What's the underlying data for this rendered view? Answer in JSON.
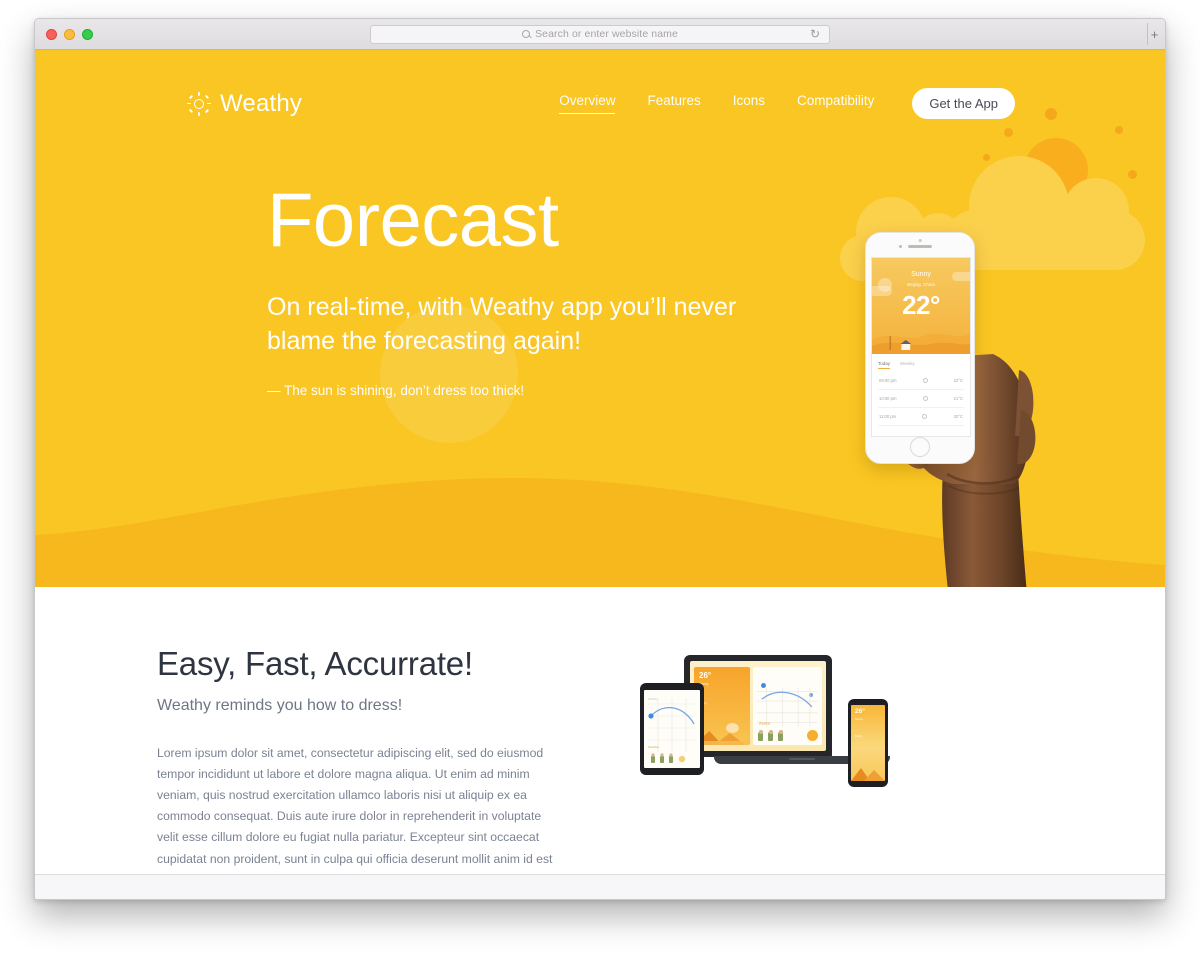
{
  "browser": {
    "address_placeholder": "Search or enter website name",
    "search_icon": "search-icon",
    "reload_icon": "↻",
    "new_tab_icon": "+",
    "traffic_lights": [
      "close",
      "minimize",
      "maximize"
    ]
  },
  "nav": {
    "brand": "Weathy",
    "brand_icon": "sun-icon",
    "links": [
      {
        "label": "Overview",
        "active": true
      },
      {
        "label": "Features",
        "active": false
      },
      {
        "label": "Icons",
        "active": false
      },
      {
        "label": "Compatibility",
        "active": false
      }
    ],
    "cta_label": "Get the App"
  },
  "hero": {
    "title": "Forecast",
    "subtitle": "On real-time, with Weathy app you’ll never blame the forecasting again!",
    "note": "— The sun is shining, don’t dress too thick!",
    "background_color": "#f9c623",
    "wave_color": "#f6b81d",
    "sun_color": "#f9ae1e",
    "cloud_color": "#fbd04b"
  },
  "phone_app": {
    "condition": "Sunny",
    "location": "Beijing, China",
    "temperature": "22°",
    "tabs": [
      {
        "label": "Today",
        "active": true
      },
      {
        "label": "Weekly",
        "active": false
      }
    ],
    "rows": [
      {
        "time": "09:00 pm",
        "icon": "sun-icon",
        "temp": "22°C"
      },
      {
        "time": "10:00 pm",
        "icon": "sun-icon",
        "temp": "21°C"
      },
      {
        "time": "11:00 pm",
        "icon": "sun-icon",
        "temp": "20°C"
      }
    ]
  },
  "features": {
    "title": "Easy, Fast, Accurrate!",
    "subtitle": "Weathy reminds you how to dress!",
    "paragraph": "Lorem ipsum dolor sit amet, consectetur adipiscing elit, sed do eiusmod tempor incididunt ut labore et dolore magna aliqua. Ut enim ad minim veniam, quis nostrud exercitation ullamco laboris nisi ut aliquip ex ea commodo consequat. Duis aute irure dolor in reprehenderit in voluptate velit esse cillum dolore eu fugiat nulla pariatur. Excepteur sint occaecat cupidatat non proident, sunt in culpa qui officia deserunt mollit anim id est laborum.",
    "devices": {
      "laptop_card_temp": "26°",
      "laptop_card_cond": "Sunny",
      "laptop_card_meta": "Beijing",
      "phone_temp": "26°",
      "phone_cond": "Sunny",
      "phone_meta": "Beijing"
    }
  }
}
